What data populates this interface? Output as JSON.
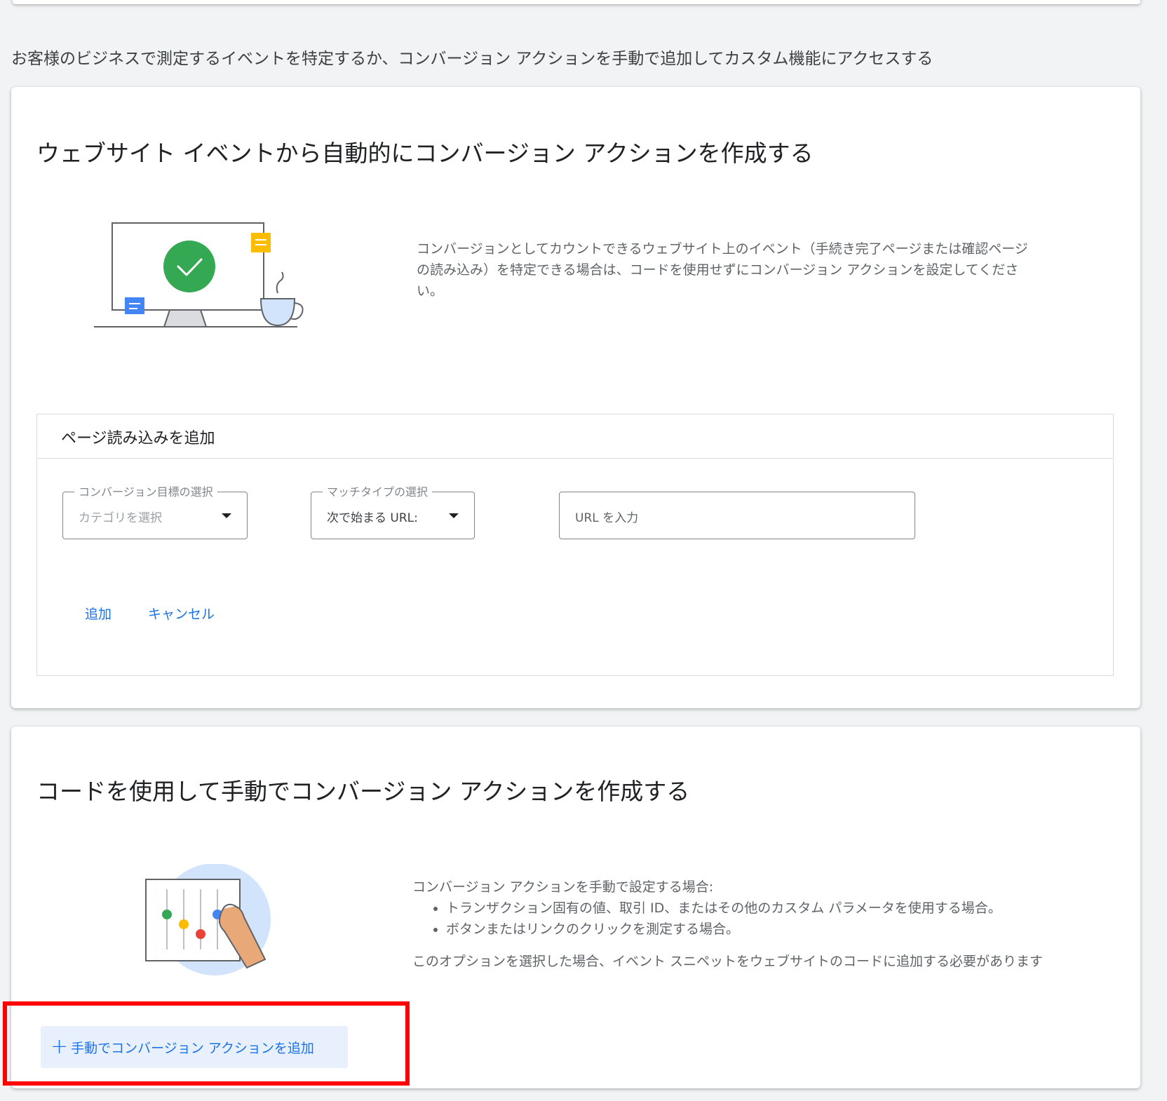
{
  "intro_text": "お客様のビジネスで測定するイベントを特定するか、コンバージョン アクションを手動で追加してカスタム機能にアクセスする",
  "auto_section": {
    "title": "ウェブサイト イベントから自動的にコンバージョン アクションを作成する",
    "description": "コンバージョンとしてカウントできるウェブサイト上のイベント（手続き完了ページまたは確認ページの読み込み）を特定できる場合は、コードを使用せずにコンバージョン アクションを設定してください。",
    "page_load": {
      "title": "ページ読み込みを追加",
      "goal_select": {
        "label": "コンバージョン目標の選択",
        "placeholder": "カテゴリを選択"
      },
      "match_select": {
        "label": "マッチタイプの選択",
        "value": "次で始まる URL:"
      },
      "url_input": {
        "placeholder": "URL を入力"
      },
      "add_label": "追加",
      "cancel_label": "キャンセル"
    }
  },
  "manual_section": {
    "title": "コードを使用して手動でコンバージョン アクションを作成する",
    "intro": "コンバージョン アクションを手動で設定する場合:",
    "bullets": [
      "トランザクション固有の値、取引 ID、またはその他のカスタム パラメータを使用する場合。",
      "ボタンまたはリンクのクリックを測定する場合。"
    ],
    "note": "このオプションを選択した場合、イベント スニペットをウェブサイトのコードに追加する必要があります",
    "add_manual_label": "手動でコンバージョン アクションを追加"
  },
  "colors": {
    "accent": "#1a73e8",
    "highlight": "#ff0000",
    "check_green": "#34a853",
    "note_yellow": "#fbbc04",
    "note_blue": "#4285f4"
  }
}
